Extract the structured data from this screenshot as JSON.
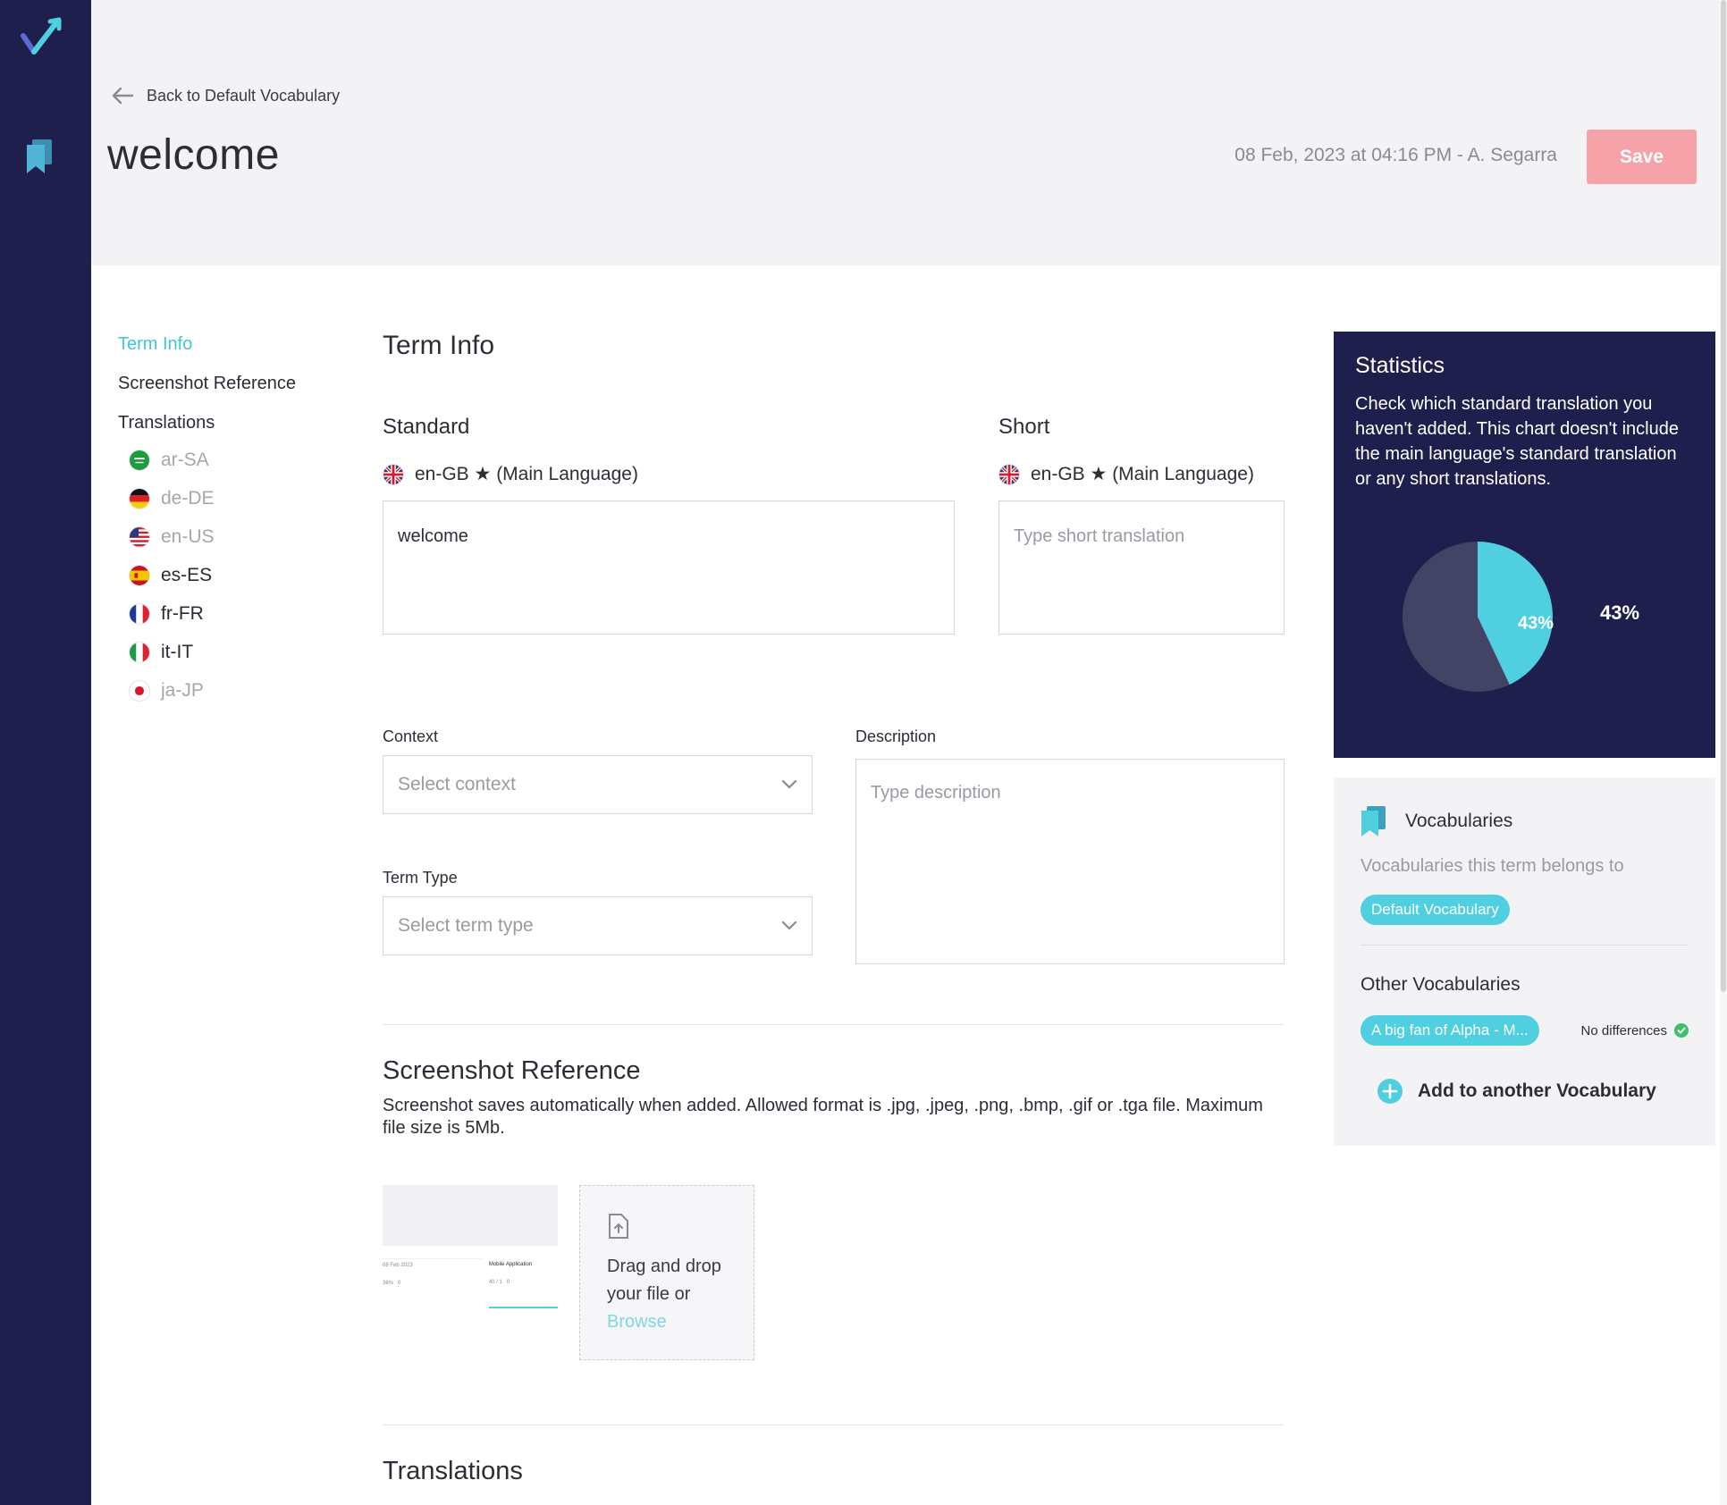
{
  "header": {
    "back_label": "Back to Default Vocabulary",
    "title": "welcome",
    "meta": "08 Feb, 2023 at 04:16 PM - A. Segarra",
    "save_label": "Save"
  },
  "toc": {
    "term_info": "Term Info",
    "screenshot_reference": "Screenshot Reference",
    "translations": "Translations",
    "languages": [
      {
        "code": "ar-SA",
        "muted": true
      },
      {
        "code": "de-DE",
        "muted": true
      },
      {
        "code": "en-US",
        "muted": true
      },
      {
        "code": "es-ES",
        "muted": false
      },
      {
        "code": "fr-FR",
        "muted": false
      },
      {
        "code": "it-IT",
        "muted": false
      },
      {
        "code": "ja-JP",
        "muted": true
      }
    ]
  },
  "term_info": {
    "title": "Term Info",
    "standard": {
      "title": "Standard",
      "language": "en-GB ★ (Main Language)",
      "value": "welcome"
    },
    "short": {
      "title": "Short",
      "language": "en-GB ★ (Main Language)",
      "placeholder": "Type short translation"
    },
    "context": {
      "label": "Context",
      "placeholder": "Select context"
    },
    "term_type": {
      "label": "Term Type",
      "placeholder": "Select term type"
    },
    "description": {
      "label": "Description",
      "placeholder": "Type description"
    }
  },
  "screenshot": {
    "title": "Screenshot Reference",
    "help": "Screenshot saves automatically when added. Allowed format is .jpg, .jpeg, .png, .bmp, .gif or .tga file. Maximum file size is 5Mb.",
    "drop_text": "Drag and drop your file or",
    "browse_label": "Browse",
    "thumb_title": "Mobile Application"
  },
  "translations_section": {
    "title": "Translations"
  },
  "statistics": {
    "title": "Statistics",
    "description": "Check which standard translation you haven't added. This chart doesn't include the main language's standard translation or any short translations.",
    "pct_inside": "43%",
    "pct_outside": "43%"
  },
  "chart_data": {
    "type": "pie",
    "values": [
      43,
      57
    ],
    "colors": [
      "#4fcfe0",
      "#434366"
    ]
  },
  "vocabularies": {
    "title": "Vocabularies",
    "subtitle": "Vocabularies this term belongs to",
    "current": "Default Vocabulary",
    "other_title": "Other Vocabularies",
    "other_chip": "A big fan of Alpha - M...",
    "no_diff": "No differences",
    "add_label": "Add to another Vocabulary"
  },
  "colors": {
    "sidebar": "#1f1f4d",
    "accent": "#4fcfe0",
    "save": "#f5a3a8"
  }
}
